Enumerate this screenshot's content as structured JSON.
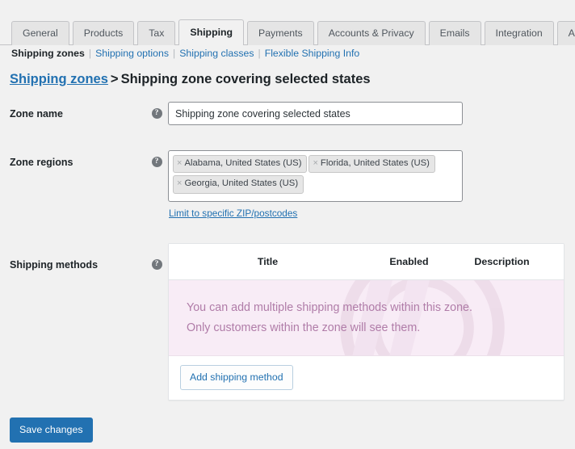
{
  "tabs": [
    {
      "label": "General",
      "active": false
    },
    {
      "label": "Products",
      "active": false
    },
    {
      "label": "Tax",
      "active": false
    },
    {
      "label": "Shipping",
      "active": true
    },
    {
      "label": "Payments",
      "active": false
    },
    {
      "label": "Accounts & Privacy",
      "active": false
    },
    {
      "label": "Emails",
      "active": false
    },
    {
      "label": "Integration",
      "active": false
    },
    {
      "label": "Advanced",
      "active": false
    }
  ],
  "subnav": {
    "current": "Shipping zones",
    "links": [
      "Shipping options",
      "Shipping classes",
      "Flexible Shipping Info"
    ],
    "separator": "|"
  },
  "heading": {
    "link": "Shipping zones",
    "separator": ">",
    "title": "Shipping zone covering selected states"
  },
  "fields": {
    "zone_name": {
      "label": "Zone name",
      "help_icon": "question-mark-icon",
      "value": "Shipping zone covering selected states",
      "placeholder": "Zone name"
    },
    "zone_regions": {
      "label": "Zone regions",
      "help_icon": "question-mark-icon",
      "tags": [
        {
          "remove_icon": "×",
          "label": "Alabama, United States (US)"
        },
        {
          "remove_icon": "×",
          "label": "Florida, United States (US)"
        },
        {
          "remove_icon": "×",
          "label": "Georgia, United States (US)"
        }
      ],
      "zip_link": "Limit to specific ZIP/postcodes"
    },
    "shipping_methods": {
      "label": "Shipping methods",
      "help_icon": "question-mark-icon",
      "columns": [
        "Title",
        "Enabled",
        "Description"
      ],
      "notice_line1": "You can add multiple shipping methods within this zone.",
      "notice_line2": "Only customers within the zone will see them.",
      "add_button": "Add shipping method"
    }
  },
  "footer": {
    "save_label": "Save changes"
  },
  "colors": {
    "page_background": "#f1f1f1",
    "link": "#2271b1",
    "primary_button": "#2271b1",
    "notice_background": "#f8ecf6",
    "notice_text": "#b07ca8",
    "tab_inactive": "#e5e5e5",
    "border": "#c3c4c7"
  }
}
